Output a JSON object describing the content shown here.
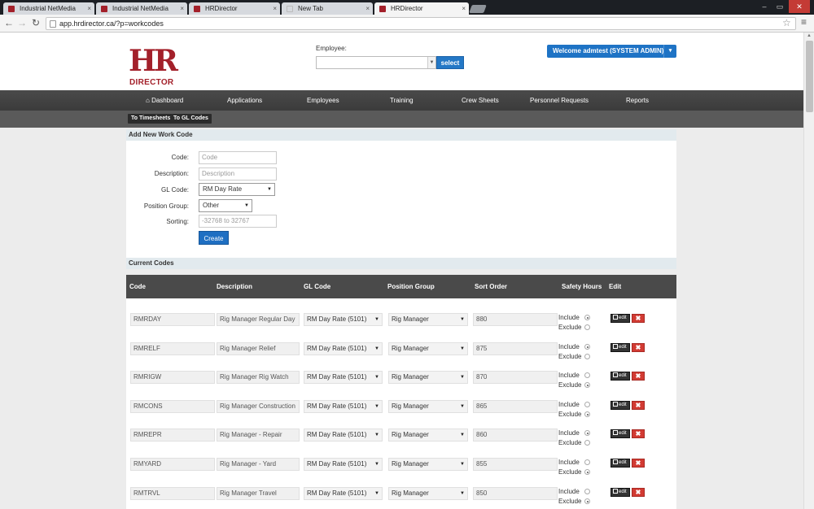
{
  "browser": {
    "tabs": [
      {
        "label": "Industrial NetMedia",
        "active": false
      },
      {
        "label": "Industrial NetMedia",
        "active": false
      },
      {
        "label": "HRDirector",
        "active": false
      },
      {
        "label": "New Tab",
        "active": false
      },
      {
        "label": "HRDirector",
        "active": true
      }
    ],
    "url": "app.hrdirector.ca/?p=workcodes"
  },
  "header": {
    "logo_hr": "HR",
    "logo_director": "DIRECTOR",
    "employee_label": "Employee:",
    "select_button": "select",
    "welcome": "Welcome admtest (SYSTEM ADMIN)"
  },
  "nav": {
    "items": [
      "Dashboard",
      "Applications",
      "Employees",
      "Training",
      "Crew Sheets",
      "Personnel Requests",
      "Reports"
    ]
  },
  "subnav": {
    "timesheets": "To Timesheets",
    "glcodes": "To GL Codes"
  },
  "add_form": {
    "title": "Add New Work Code",
    "code_label": "Code:",
    "code_placeholder": "Code",
    "description_label": "Description:",
    "description_placeholder": "Description",
    "glcode_label": "GL Code:",
    "glcode_value": "RM Day Rate",
    "position_group_label": "Position Group:",
    "position_group_value": "Other",
    "sorting_label": "Sorting:",
    "sorting_placeholder": "-32768 to 32767",
    "create_button": "Create"
  },
  "current": {
    "title": "Current Codes",
    "columns": [
      "Code",
      "Description",
      "GL Code",
      "Position Group",
      "Sort Order",
      "Safety Hours",
      "Edit"
    ],
    "include_label": "Include",
    "exclude_label": "Exclude",
    "edit_label": "edit",
    "delete_label": "✖",
    "rows": [
      {
        "code": "RMRDAY",
        "description": "Rig Manager Regular Day",
        "gl": "RM Day Rate (5101)",
        "group": "Rig Manager",
        "sort": "880",
        "safety": "include"
      },
      {
        "code": "RMRELF",
        "description": "Rig Manager Relief",
        "gl": "RM Day Rate (5101)",
        "group": "Rig Manager",
        "sort": "875",
        "safety": "include"
      },
      {
        "code": "RMRIGW",
        "description": "Rig Manager Rig Watch",
        "gl": "RM Day Rate (5101)",
        "group": "Rig Manager",
        "sort": "870",
        "safety": "exclude"
      },
      {
        "code": "RMCONS",
        "description": "Rig Manager Construction",
        "gl": "RM Day Rate (5101)",
        "group": "Rig Manager",
        "sort": "865",
        "safety": "exclude"
      },
      {
        "code": "RMREPR",
        "description": "Rig Manager - Repair",
        "gl": "RM Day Rate (5101)",
        "group": "Rig Manager",
        "sort": "860",
        "safety": "include"
      },
      {
        "code": "RMYARD",
        "description": "Rig Manager - Yard",
        "gl": "RM Day Rate (5101)",
        "group": "Rig Manager",
        "sort": "855",
        "safety": "exclude"
      },
      {
        "code": "RMTRVL",
        "description": "Rig Manager Travel",
        "gl": "RM Day Rate (5101)",
        "group": "Rig Manager",
        "sort": "850",
        "safety": "exclude"
      }
    ]
  },
  "colors": {
    "brand": "#a3202a",
    "primary_button": "#1f6fc2",
    "nav_bg": "#3f3f3f",
    "delete": "#d23b33"
  }
}
